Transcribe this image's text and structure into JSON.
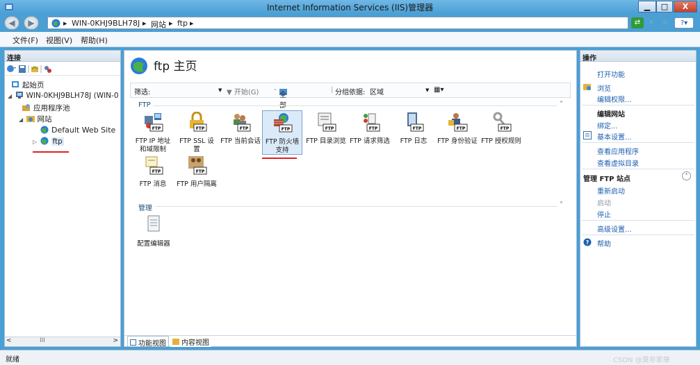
{
  "window": {
    "title": "Internet Information Services (IIS)管理器",
    "minimize": "▁",
    "maximize": "□",
    "close": "X"
  },
  "address": {
    "crumbs": [
      "WIN-0KHJ9BLH78J",
      "网站",
      "ftp"
    ],
    "separator": "▸"
  },
  "menu": {
    "items": [
      "文件(F)",
      "视图(V)",
      "帮助(H)"
    ]
  },
  "connections": {
    "header": "连接",
    "tree": [
      {
        "label": "起始页"
      },
      {
        "label": "WIN-0KHJ9BLH78J (WIN-0"
      },
      {
        "label": "应用程序池"
      },
      {
        "label": "网站"
      },
      {
        "label": "Default Web Site"
      },
      {
        "label": "ftp"
      }
    ],
    "scroll_label": "III"
  },
  "main": {
    "title": "ftp 主页",
    "filter": {
      "label": "筛选:",
      "start": "▼ 开始(G)",
      "show_all": "全部显示(A)",
      "group_by_label": "分组依据:",
      "group_by_value": "区域"
    },
    "groups": [
      {
        "name": "FTP",
        "features": [
          {
            "label": "FTP IP 地址和域限制"
          },
          {
            "label": "FTP SSL 设置"
          },
          {
            "label": "FTP 当前会话"
          },
          {
            "label": "FTP 防火墙支持"
          },
          {
            "label": "FTP 目录浏览"
          },
          {
            "label": "FTP 请求筛选"
          },
          {
            "label": "FTP 日志"
          },
          {
            "label": "FTP 身份验证"
          },
          {
            "label": "FTP 授权规则"
          },
          {
            "label": "FTP 消息"
          },
          {
            "label": "FTP 用户隔离"
          }
        ]
      },
      {
        "name": "管理",
        "features": [
          {
            "label": "配置编辑器"
          }
        ]
      }
    ],
    "tabs": [
      "功能视图",
      "内容视图"
    ]
  },
  "actions": {
    "header": "操作",
    "open_feature": "打开功能",
    "browse": "浏览",
    "edit_permissions": "编辑权限...",
    "edit_site_head": "编辑网站",
    "bindings": "绑定...",
    "basic_settings": "基本设置...",
    "view_apps": "查看应用程序",
    "view_vdirs": "查看虚拟目录",
    "manage_ftp_head": "管理 FTP 站点",
    "restart": "重新启动",
    "start": "启动",
    "stop": "停止",
    "advanced": "高级设置...",
    "help": "帮助"
  },
  "status": {
    "text": "就绪",
    "watermark": "CSDN @莫非家康"
  },
  "colors": {
    "accent": "#1c5fb0",
    "titlebar": "#4a9fd4",
    "annotation": "#e02020"
  }
}
